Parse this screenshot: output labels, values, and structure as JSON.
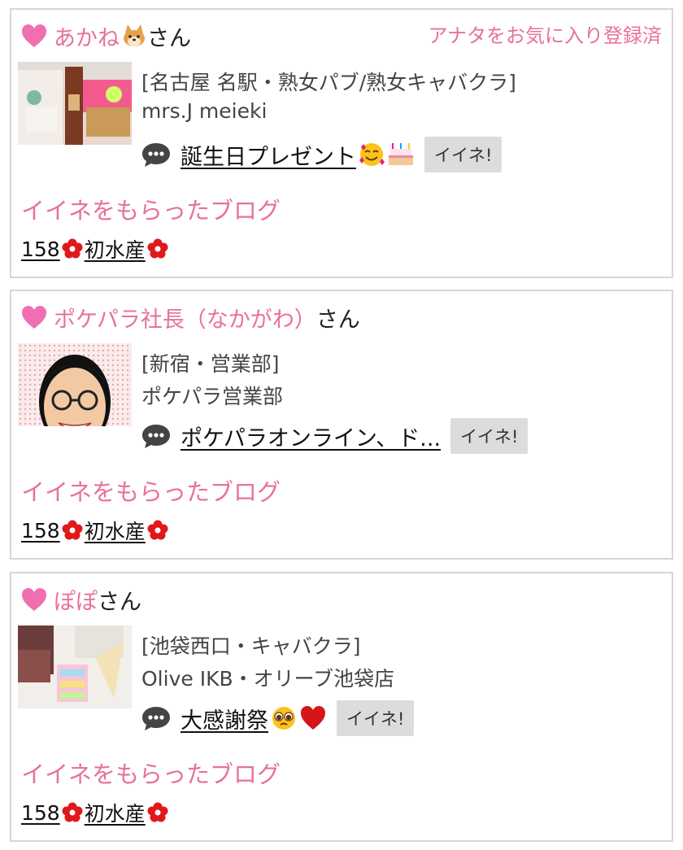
{
  "favorite_status": "アナタをお気に入り登録済",
  "section_label": "イイネをもらったブログ",
  "iine_label": "イイネ!",
  "san_suffix": "さん",
  "accent_color": "#e8719a",
  "cards": [
    {
      "user_name": "あかね",
      "user_emoji": "shiba-dog-emoji",
      "shop_area": "[名古屋 名駅・熟女パブ/熟女キャバクラ]",
      "shop_name": "mrs.J meieki",
      "blog_title": "誕生日プレゼント",
      "blog_emojis": [
        "smiling-face-with-hearts-emoji",
        "birthday-cake-emoji"
      ],
      "entry_number": "158",
      "entry_title": "初水産"
    },
    {
      "user_name": "ポケパラ社長（なかがわ）",
      "shop_area": "[新宿・営業部]",
      "shop_name": "ポケパラ営業部",
      "blog_title": "ポケパラオンライン、ド...",
      "entry_number": "158",
      "entry_title": "初水産"
    },
    {
      "user_name": "ぽぽ",
      "shop_area": "[池袋西口・キャバクラ]",
      "shop_name": "Olive IKB・オリーブ池袋店",
      "blog_title": "大感謝祭",
      "blog_emojis": [
        "pleading-face-emoji",
        "red-heart-emoji"
      ],
      "entry_number": "158",
      "entry_title": "初水産"
    }
  ]
}
